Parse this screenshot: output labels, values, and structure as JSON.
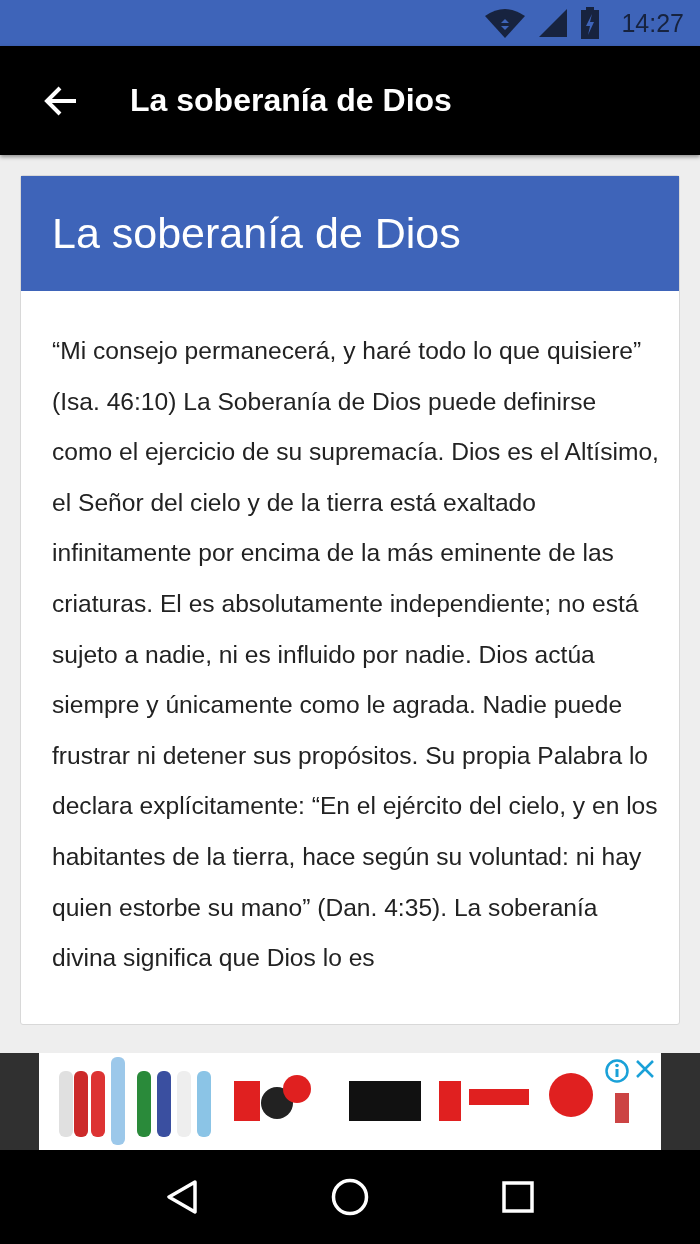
{
  "status_bar": {
    "time": "14:27"
  },
  "app_bar": {
    "title": "La soberanía de Dios"
  },
  "card": {
    "title": "La soberanía de Dios",
    "body": "“Mi consejo permanecerá, y haré todo lo que quisiere” (Isa. 46:10) La Soberanía de Dios puede definirse como el ejercicio de su supremacía. Dios es el Altísimo, el Señor del cielo y de la tierra está exaltado infinitamente por encima de la más eminente de las criaturas. El es absolutamente independiente; no está sujeto a nadie, ni es influido por nadie. Dios actúa siempre y únicamente como le agrada. Nadie puede frustrar ni detener sus propósitos. Su propia Palabra lo declara explícitamente: “En el ejército del cielo, y en los habitantes de la tierra, hace según su voluntad: ni hay quien estorbe su mano” (Dan. 4:35). La soberanía divina significa que Dios lo es"
  }
}
